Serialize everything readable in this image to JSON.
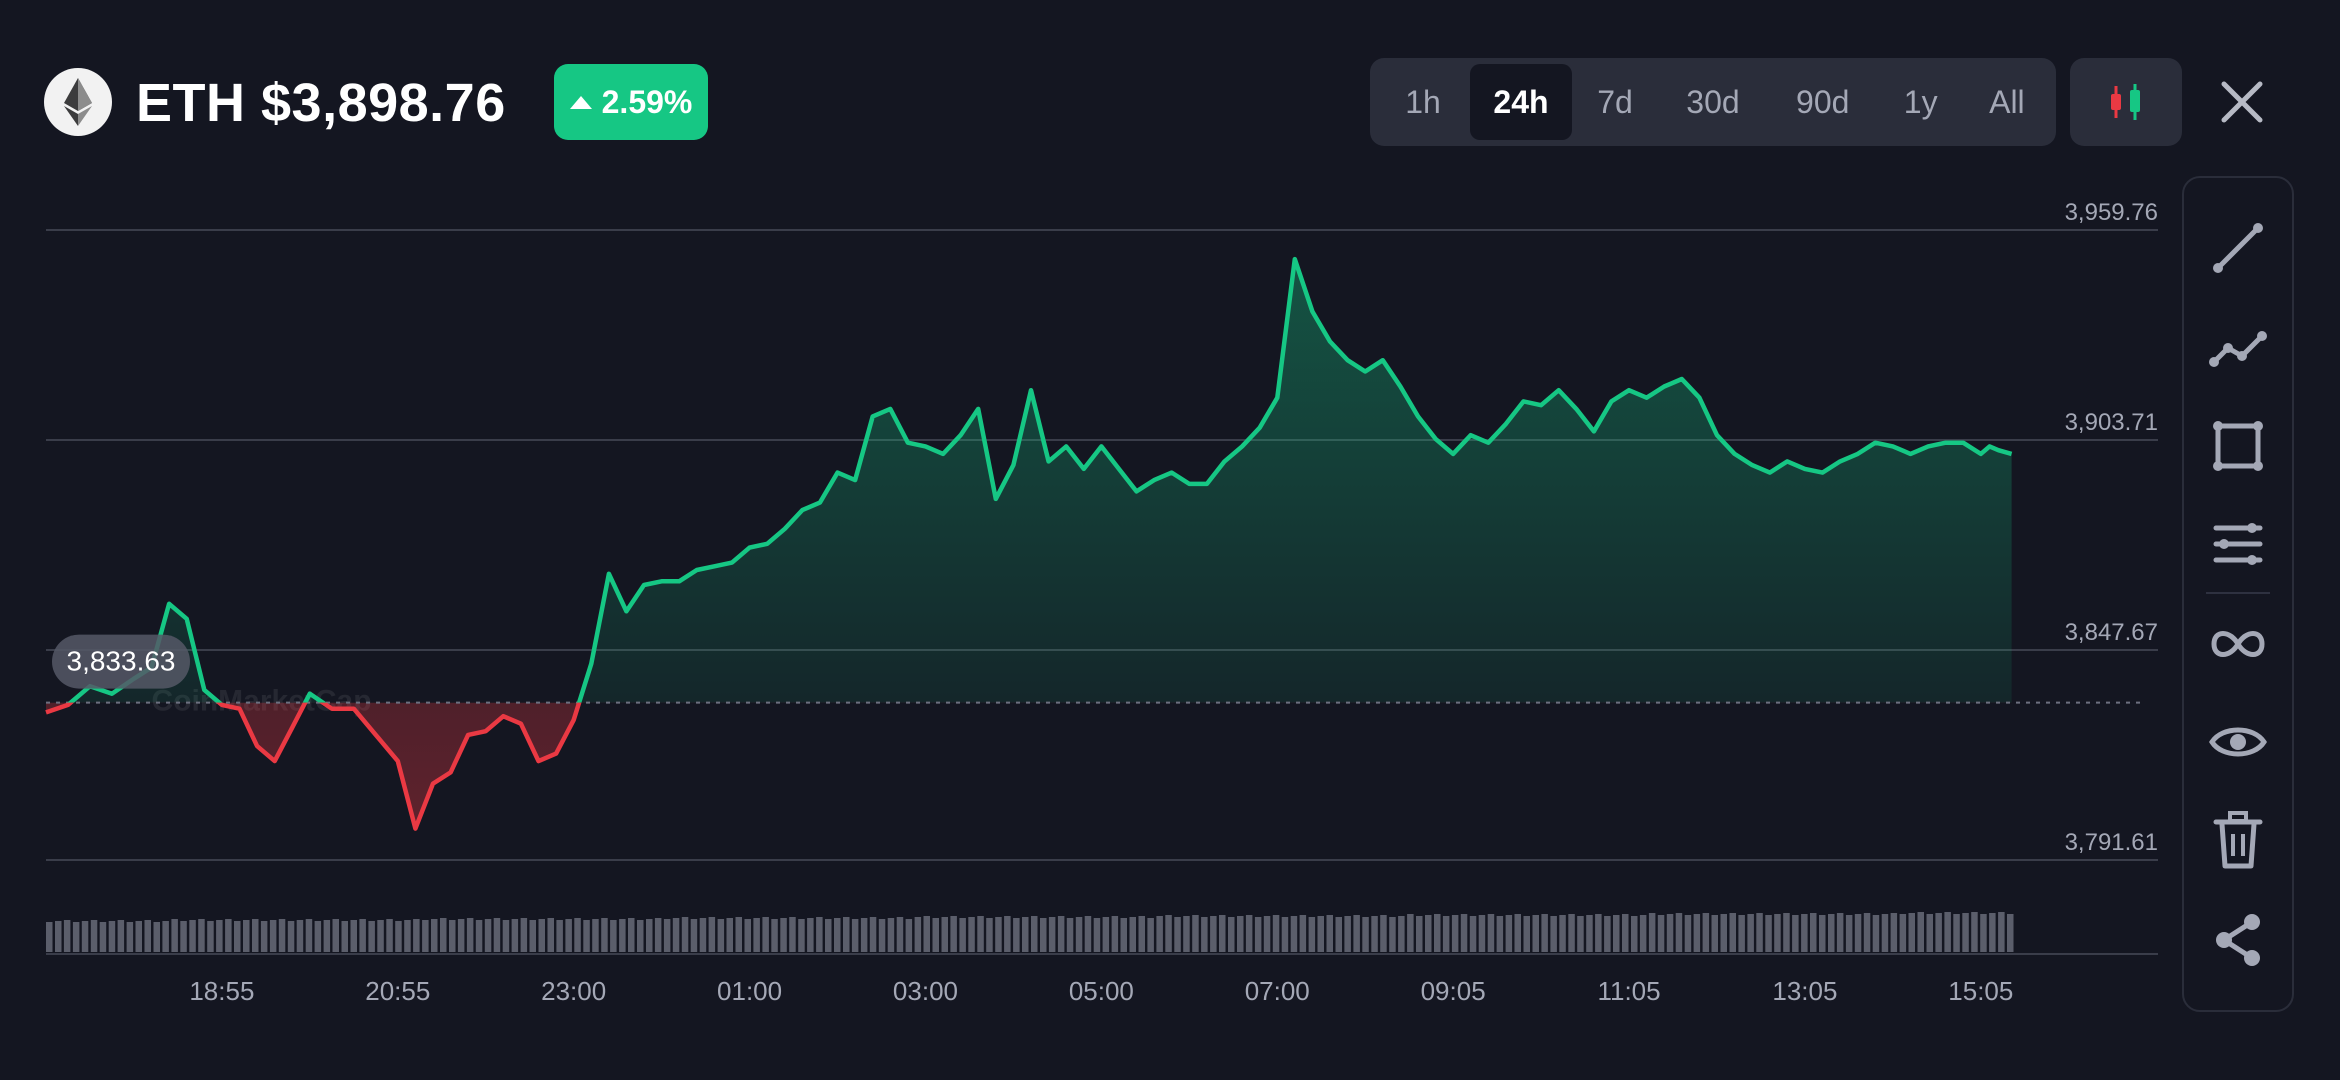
{
  "header": {
    "coin_icon": "ethereum-diamond-icon",
    "price_title": "ETH $3,898.76",
    "change": {
      "value": "2.59%",
      "direction": "up",
      "color": "#16c784"
    }
  },
  "range_tabs": [
    {
      "label": "1h",
      "active": false
    },
    {
      "label": "24h",
      "active": true
    },
    {
      "label": "7d",
      "active": false
    },
    {
      "label": "30d",
      "active": false
    },
    {
      "label": "90d",
      "active": false
    },
    {
      "label": "1y",
      "active": false
    },
    {
      "label": "All",
      "active": false
    }
  ],
  "toolbar_icons": [
    "candlestick-chart-icon",
    "close-icon"
  ],
  "drawing_tools": [
    "trend-line-icon",
    "polyline-icon",
    "rectangle-icon",
    "horizontal-lines-icon",
    "infinity-icon",
    "eye-icon",
    "trash-icon",
    "share-icon"
  ],
  "colors": {
    "up": "#16c784",
    "down": "#ea3943",
    "background": "#141621",
    "grid": "#3a3d4a",
    "volume": "#5b5e6b"
  },
  "chart_data": {
    "type": "line",
    "ylim": [
      3791.61,
      3959.76
    ],
    "y_ticks": [
      "3,959.76",
      "3,903.71",
      "3,847.67",
      "3,791.61"
    ],
    "x_ticks": [
      "18:55",
      "20:55",
      "23:00",
      "01:00",
      "03:00",
      "05:00",
      "07:00",
      "09:05",
      "11:05",
      "13:05",
      "15:05"
    ],
    "x_tick_positions_h": [
      1.0,
      3.0,
      5.0,
      7.0,
      9.0,
      11.0,
      13.0,
      15.0,
      17.0,
      19.0,
      21.0
    ],
    "x_range_h": [
      -1.0,
      21.4
    ],
    "reference_price": 3833.63,
    "reference_label": "3,833.63",
    "watermark": "CoinMarketCap",
    "series": [
      {
        "x_h": [
          -1.0,
          -0.75,
          -0.5,
          -0.25,
          0.0,
          0.2,
          0.4,
          0.6,
          0.8,
          1.0,
          1.2,
          1.4,
          1.6,
          1.8,
          2.0,
          2.25,
          2.5,
          2.75,
          3.0,
          3.2,
          3.4,
          3.6,
          3.8,
          4.0,
          4.2,
          4.4,
          4.6,
          4.8,
          5.0,
          5.2,
          5.4,
          5.6,
          5.8,
          6.0,
          6.2,
          6.4,
          6.6,
          6.8,
          7.0,
          7.2,
          7.4,
          7.6,
          7.8,
          8.0,
          8.2,
          8.4,
          8.6,
          8.8,
          9.0,
          9.2,
          9.4,
          9.6,
          9.8,
          10.0,
          10.2,
          10.4,
          10.6,
          10.8,
          11.0,
          11.2,
          11.4,
          11.6,
          11.8,
          12.0,
          12.2,
          12.4,
          12.6,
          12.8,
          13.0,
          13.2,
          13.4,
          13.6,
          13.8,
          14.0,
          14.2,
          14.4,
          14.6,
          14.8,
          15.0,
          15.2,
          15.4,
          15.6,
          15.8,
          16.0,
          16.2,
          16.4,
          16.6,
          16.8,
          17.0,
          17.2,
          17.4,
          17.6,
          17.8,
          18.0,
          18.2,
          18.4,
          18.6,
          18.8,
          19.0,
          19.2,
          19.4,
          19.6,
          19.8,
          20.0,
          20.2,
          20.4,
          20.6,
          20.8,
          21.0,
          21.1,
          21.2,
          21.35
        ],
        "y": [
          3831,
          3833,
          3838,
          3836,
          3840,
          3843,
          3860,
          3856,
          3837,
          3833,
          3832,
          3822,
          3818,
          3827,
          3836,
          3832,
          3832,
          3825,
          3818,
          3800,
          3812,
          3815,
          3825,
          3826,
          3830,
          3828,
          3818,
          3820,
          3829,
          3844,
          3868,
          3858,
          3865,
          3866,
          3866,
          3869,
          3870,
          3871,
          3875,
          3876,
          3880,
          3885,
          3887,
          3895,
          3893,
          3910,
          3912,
          3903,
          3902,
          3900,
          3905,
          3912,
          3888,
          3897,
          3917,
          3898,
          3902,
          3896,
          3902,
          3896,
          3890,
          3893,
          3895,
          3892,
          3892,
          3898,
          3902,
          3907,
          3915,
          3952,
          3938,
          3930,
          3925,
          3922,
          3925,
          3918,
          3910,
          3904,
          3900,
          3905,
          3903,
          3908,
          3914,
          3913,
          3917,
          3912,
          3906,
          3914,
          3917,
          3915,
          3918,
          3920,
          3915,
          3905,
          3900,
          3897,
          3895,
          3898,
          3896,
          3895,
          3898,
          3900,
          3903,
          3902,
          3900,
          3902,
          3903,
          3903,
          3900,
          3902,
          3901,
          3900,
          3899
        ]
      }
    ],
    "volume_bars": 220
  }
}
